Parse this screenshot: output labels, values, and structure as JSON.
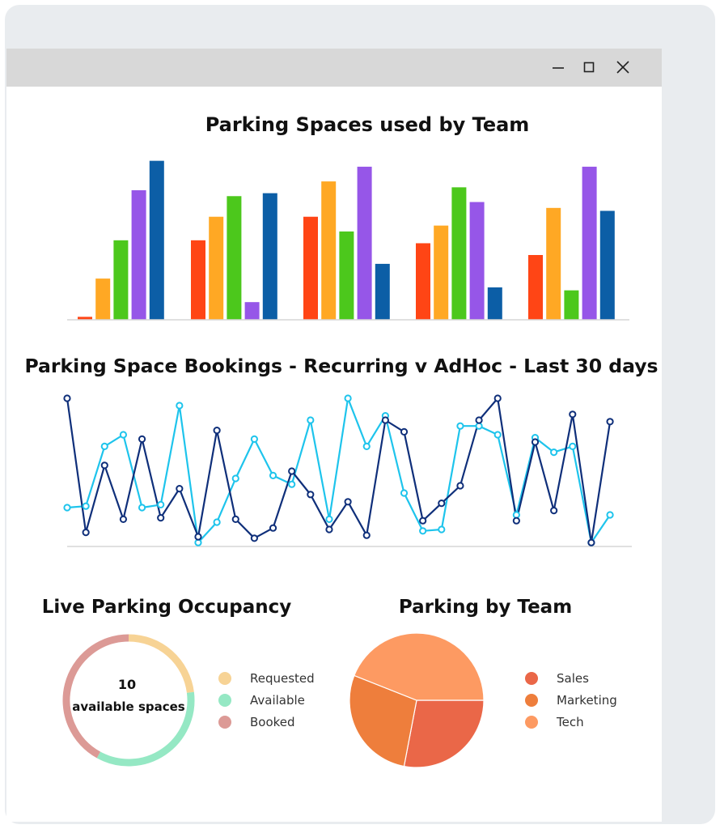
{
  "window": {
    "controls": [
      "minimize",
      "maximize",
      "close"
    ]
  },
  "colors": {
    "backdrop": "#e9ecef",
    "titlebar": "#d8d8d8",
    "bar_series": [
      "#ff4515",
      "#ffa824",
      "#4cc81c",
      "#9656e8",
      "#0c5ea6"
    ],
    "line_dark": "#0f2f7a",
    "line_light": "#1ec4ec",
    "donut": [
      "#f7d395",
      "#95e8c4",
      "#dc9a96"
    ],
    "pie": [
      "#ea6748",
      "#ee7e3c",
      "#fd9a62"
    ]
  },
  "chart_data": [
    {
      "type": "bar",
      "title": "Parking Spaces used by Team",
      "categories": [
        "",
        "",
        "",
        "",
        ""
      ],
      "series": [
        {
          "values": [
            1,
            27,
            35,
            26,
            22
          ]
        },
        {
          "values": [
            14,
            35,
            47,
            32,
            38
          ]
        },
        {
          "values": [
            27,
            42,
            30,
            45,
            10
          ]
        },
        {
          "values": [
            44,
            6,
            52,
            40,
            52
          ]
        },
        {
          "values": [
            54,
            43,
            19,
            11,
            37
          ]
        }
      ],
      "ylim": [
        0,
        55
      ],
      "grid": false,
      "legend": "none"
    },
    {
      "type": "line",
      "title": "Parking Space Bookings - Recurring v AdHoc - Last 30 days",
      "x": [
        1,
        2,
        3,
        4,
        5,
        6,
        7,
        8,
        9,
        10,
        11,
        12,
        13,
        14,
        15,
        16,
        17,
        18,
        19,
        20,
        21,
        22,
        23,
        24,
        25,
        26,
        27,
        28,
        29,
        30,
        31
      ],
      "series": [
        {
          "values": [
            100,
            8,
            54,
            17,
            72,
            18,
            38,
            5,
            78,
            17,
            4,
            11,
            50,
            34,
            10,
            29,
            6,
            85,
            77,
            16,
            28,
            40,
            85,
            100,
            16,
            70,
            23,
            89,
            1,
            84
          ]
        },
        {
          "values": [
            25,
            26,
            67,
            75,
            25,
            27,
            95,
            1,
            15,
            45,
            72,
            47,
            41,
            85,
            17,
            100,
            67,
            88,
            35,
            9,
            10,
            81,
            81,
            75,
            20,
            73,
            63,
            67,
            1,
            20
          ]
        }
      ],
      "ylim": [
        0,
        100
      ],
      "grid": false,
      "legend": "none"
    },
    {
      "type": "pie",
      "title": "Live Parking Occupancy",
      "donut": true,
      "center_value": "10",
      "center_label": "available spaces",
      "labels": [
        "Requested",
        "Available",
        "Booked"
      ],
      "values": [
        23,
        35,
        42
      ],
      "legend": "right"
    },
    {
      "type": "pie",
      "title": "Parking by Team",
      "labels": [
        "Sales",
        "Marketing",
        "Tech"
      ],
      "values": [
        28,
        28,
        44
      ],
      "legend": "right"
    }
  ]
}
